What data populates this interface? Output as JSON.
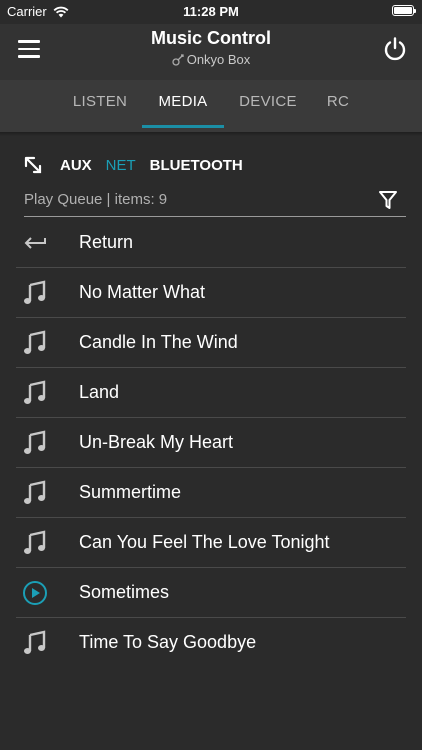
{
  "status": {
    "carrier": "Carrier",
    "time": "11:28 PM"
  },
  "header": {
    "title": "Music Control",
    "device": "Onkyo Box"
  },
  "tabs": [
    {
      "label": "LISTEN",
      "active": false
    },
    {
      "label": "MEDIA",
      "active": true
    },
    {
      "label": "DEVICE",
      "active": false
    },
    {
      "label": "RC",
      "active": false
    }
  ],
  "inputs": [
    {
      "label": "AUX",
      "active": false
    },
    {
      "label": "NET",
      "active": true
    },
    {
      "label": "BLUETOOTH",
      "active": false
    }
  ],
  "queue": {
    "label": "Play Queue | items: 9"
  },
  "colors": {
    "accent": "#1b9fb6",
    "background": "#2b2b2b",
    "tabbar": "#3a3a3a"
  },
  "list": [
    {
      "label": "Return",
      "icon": "return-arrow-icon"
    },
    {
      "label": "No Matter What",
      "icon": "music-note-icon"
    },
    {
      "label": "Candle In The Wind",
      "icon": "music-note-icon"
    },
    {
      "label": "Land",
      "icon": "music-note-icon"
    },
    {
      "label": "Un-Break My Heart",
      "icon": "music-note-icon"
    },
    {
      "label": "Summertime",
      "icon": "music-note-icon"
    },
    {
      "label": "Can You Feel The Love Tonight",
      "icon": "music-note-icon"
    },
    {
      "label": "Sometimes",
      "icon": "play-circle-icon"
    },
    {
      "label": "Time To Say Goodbye",
      "icon": "music-note-icon"
    }
  ]
}
